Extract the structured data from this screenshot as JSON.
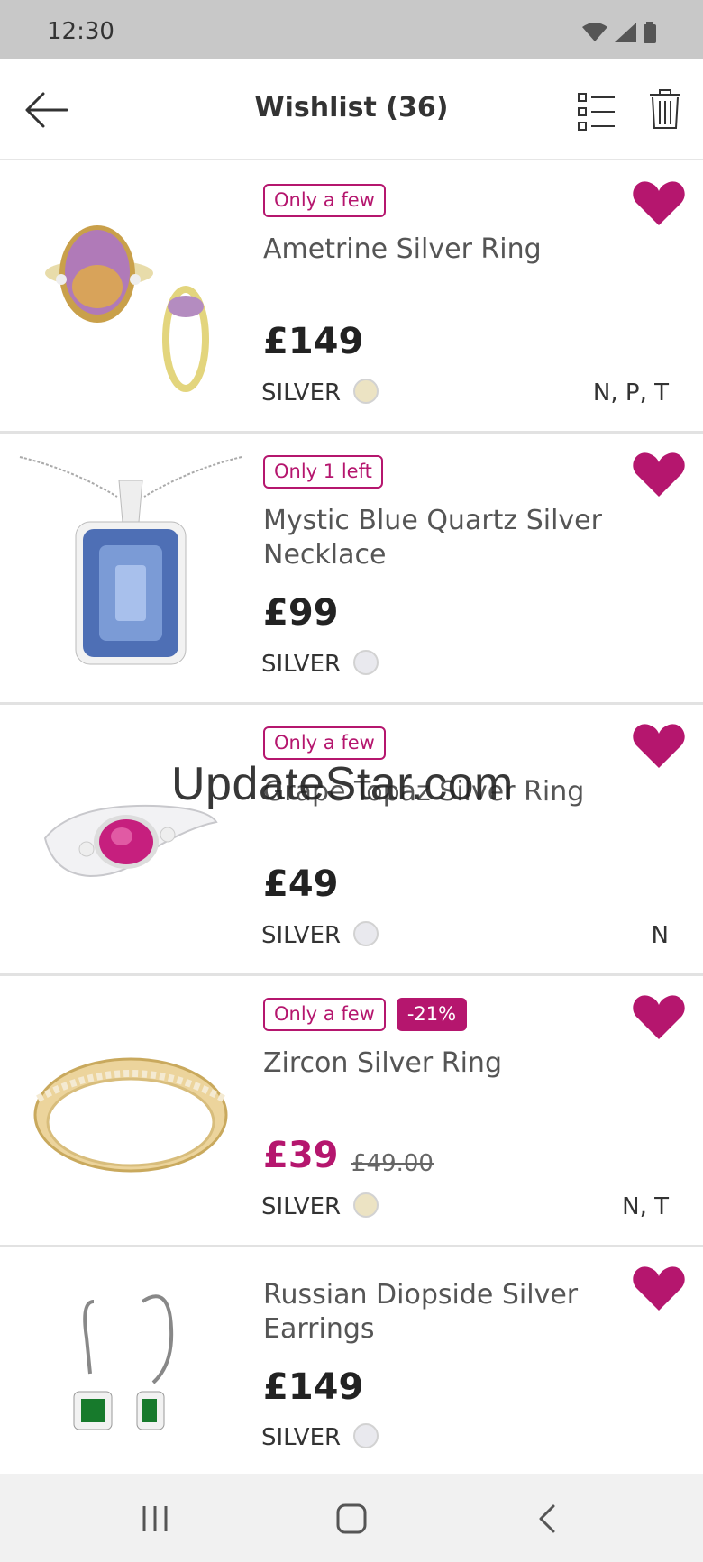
{
  "status_bar": {
    "time": "12:30",
    "icons": [
      "wifi-icon",
      "signal-icon",
      "battery-icon"
    ]
  },
  "header": {
    "title": "Wishlist (36)",
    "back_icon": "arrow-left-icon",
    "list_icon": "list-view-icon",
    "trash_icon": "trash-icon"
  },
  "colors": {
    "accent": "#b5166e",
    "gold_swatch": "#ece3c3",
    "silver_swatch": "#e9e9ee"
  },
  "items": [
    {
      "name": "Ametrine Silver Ring",
      "badges": [
        "Only a few"
      ],
      "sale_badge": "",
      "price": "£149",
      "old_price": "",
      "metal": "SILVER",
      "swatch": "gold",
      "sizes": "N, P, T",
      "favorited": true
    },
    {
      "name": "Mystic Blue Quartz Silver Necklace",
      "badges": [
        "Only 1 left"
      ],
      "sale_badge": "",
      "price": "£99",
      "old_price": "",
      "metal": "SILVER",
      "swatch": "silver",
      "sizes": "",
      "favorited": true
    },
    {
      "name": "Grape Topaz Silver Ring",
      "badges": [
        "Only a few"
      ],
      "sale_badge": "",
      "price": "£49",
      "old_price": "",
      "metal": "SILVER",
      "swatch": "silver",
      "sizes": "N",
      "favorited": true
    },
    {
      "name": "Zircon Silver Ring",
      "badges": [
        "Only a few"
      ],
      "sale_badge": "-21%",
      "price": "£39",
      "old_price": "£49.00",
      "metal": "SILVER",
      "swatch": "gold",
      "sizes": "N, T",
      "favorited": true
    },
    {
      "name": "Russian Diopside Silver Earrings",
      "badges": [],
      "sale_badge": "",
      "price": "£149",
      "old_price": "",
      "metal": "SILVER",
      "swatch": "silver",
      "sizes": "",
      "favorited": true
    }
  ],
  "watermark": "UpdateStar.com",
  "nav_bar": {
    "icons": [
      "recent-apps-icon",
      "home-icon",
      "back-icon"
    ]
  }
}
